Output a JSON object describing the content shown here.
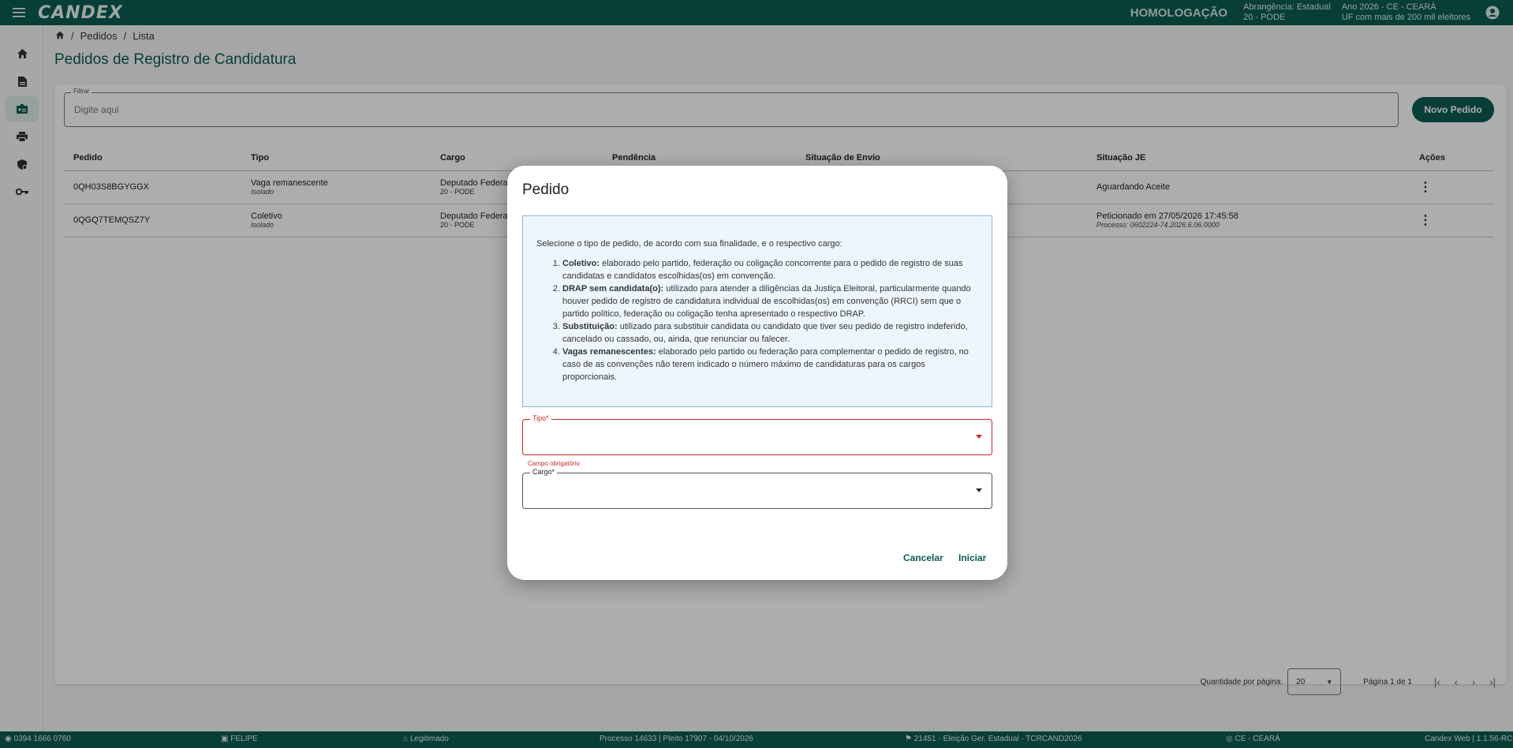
{
  "topbar": {
    "logo": "CANDEX",
    "environment": "HOMOLOGAÇÃO",
    "scope_line1": "Abrangência: Estadual",
    "scope_line2": "20 - PODE",
    "year_line1": "Ano 2026 - CE - CEARÁ",
    "year_line2": "UF com mais de 200 mil eleitores"
  },
  "sidebar": {
    "items": [
      {
        "icon": "home-icon"
      },
      {
        "icon": "document-icon"
      },
      {
        "icon": "badge-icon",
        "active": true
      },
      {
        "icon": "printer-icon"
      },
      {
        "icon": "shield-icon"
      },
      {
        "icon": "key-icon"
      }
    ]
  },
  "breadcrumb": {
    "items": [
      "Pedidos",
      "Lista"
    ]
  },
  "page": {
    "title": "Pedidos de Registro de Candidatura"
  },
  "filter": {
    "label": "Filtrar",
    "placeholder": "Digite aqui"
  },
  "new_button": "Novo Pedido",
  "table": {
    "headers": [
      "Pedido",
      "Tipo",
      "Cargo",
      "Pendência",
      "Situação de Envio",
      "Situação JE",
      "Ações"
    ],
    "rows": [
      {
        "pedido": "0QH03S8BGYGGX",
        "tipo": "Vaga remanescente",
        "tipo_sub": "Isolado",
        "cargo": "Deputado Federal",
        "cargo_sub": "20 - PODE",
        "pendencia": "",
        "envio": "",
        "je": "Aguardando Aceite",
        "je_sub": ""
      },
      {
        "pedido": "0QGQ7TEMQSZ7Y",
        "tipo": "Coletivo",
        "tipo_sub": "Isolado",
        "cargo": "Deputado Federal",
        "cargo_sub": "20 - PODE",
        "pendencia": "",
        "envio": "",
        "je": "Peticionado em 27/05/2026 17:45:58",
        "je_sub": "Processo: 0602224-74.2026.6.06.0000"
      }
    ]
  },
  "pagination": {
    "per_page_label": "Quantidade por página:",
    "per_page_value": "20",
    "page_info": "Página 1 de 1"
  },
  "footer": {
    "phone": "0394 1666 0760",
    "user": "FELIPE",
    "role": "Legitimado",
    "process": "Processo 14633 | Pleito 17907 - 04/10/2026",
    "election": "21451 - Eleição Ger. Estadual - TCRCAND2026",
    "state": "CE - CEARÁ",
    "version": "Candex Web | 1.1.56-RC"
  },
  "modal": {
    "title": "Pedido",
    "intro": "Selecione o tipo de pedido, de acordo com sua finalidade, e o respectivo cargo:",
    "items": [
      {
        "term": "Coletivo:",
        "text": " elaborado pelo partido, federação ou coligação concorrente para o pedido de registro de suas candidatas e candidatos escolhidas(os) em convenção."
      },
      {
        "term": "DRAP sem candidata(o):",
        "text": " utilizado para atender a diligências da Justiça Eleitoral, particularmente quando houver pedido de registro de candidatura individual de escolhidas(os) em convenção (RRCI) sem que o partido político, federação ou coligação tenha apresentado o respectivo DRAP."
      },
      {
        "term": "Substituição:",
        "text": " utilizado para substituir candidata ou candidato que tiver seu pedido de registro indeferido, cancelado ou cassado, ou, ainda, que renunciar ou falecer."
      },
      {
        "term": "Vagas remanescentes:",
        "text": " elaborado pelo partido ou federação para complementar o pedido de registro, no caso de as convenções não terem indicado o número máximo de candidaturas para os cargos proporcionais."
      }
    ],
    "tipo_label": "Tipo*",
    "tipo_error": "Campo obrigatório",
    "cargo_label": "Cargo*",
    "cancel": "Cancelar",
    "start": "Iniciar"
  }
}
